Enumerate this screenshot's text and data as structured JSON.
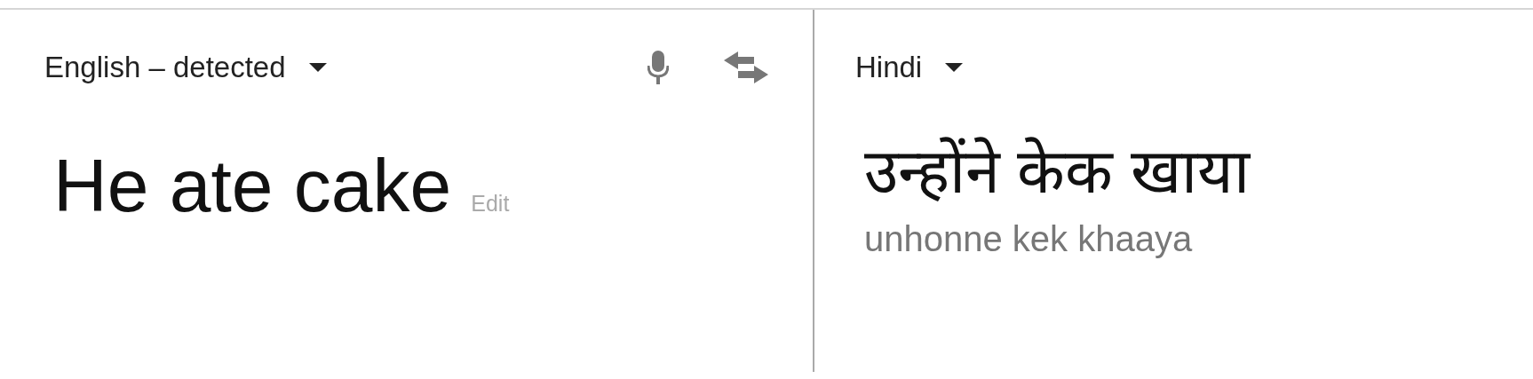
{
  "source_panel": {
    "language": "English – detected",
    "text": "He ate cake",
    "edit_link": "Edit"
  },
  "target_panel": {
    "language": "Hindi",
    "translation": "उन्होंने केक खाया",
    "transliteration": "unhonne kek khaaya"
  }
}
